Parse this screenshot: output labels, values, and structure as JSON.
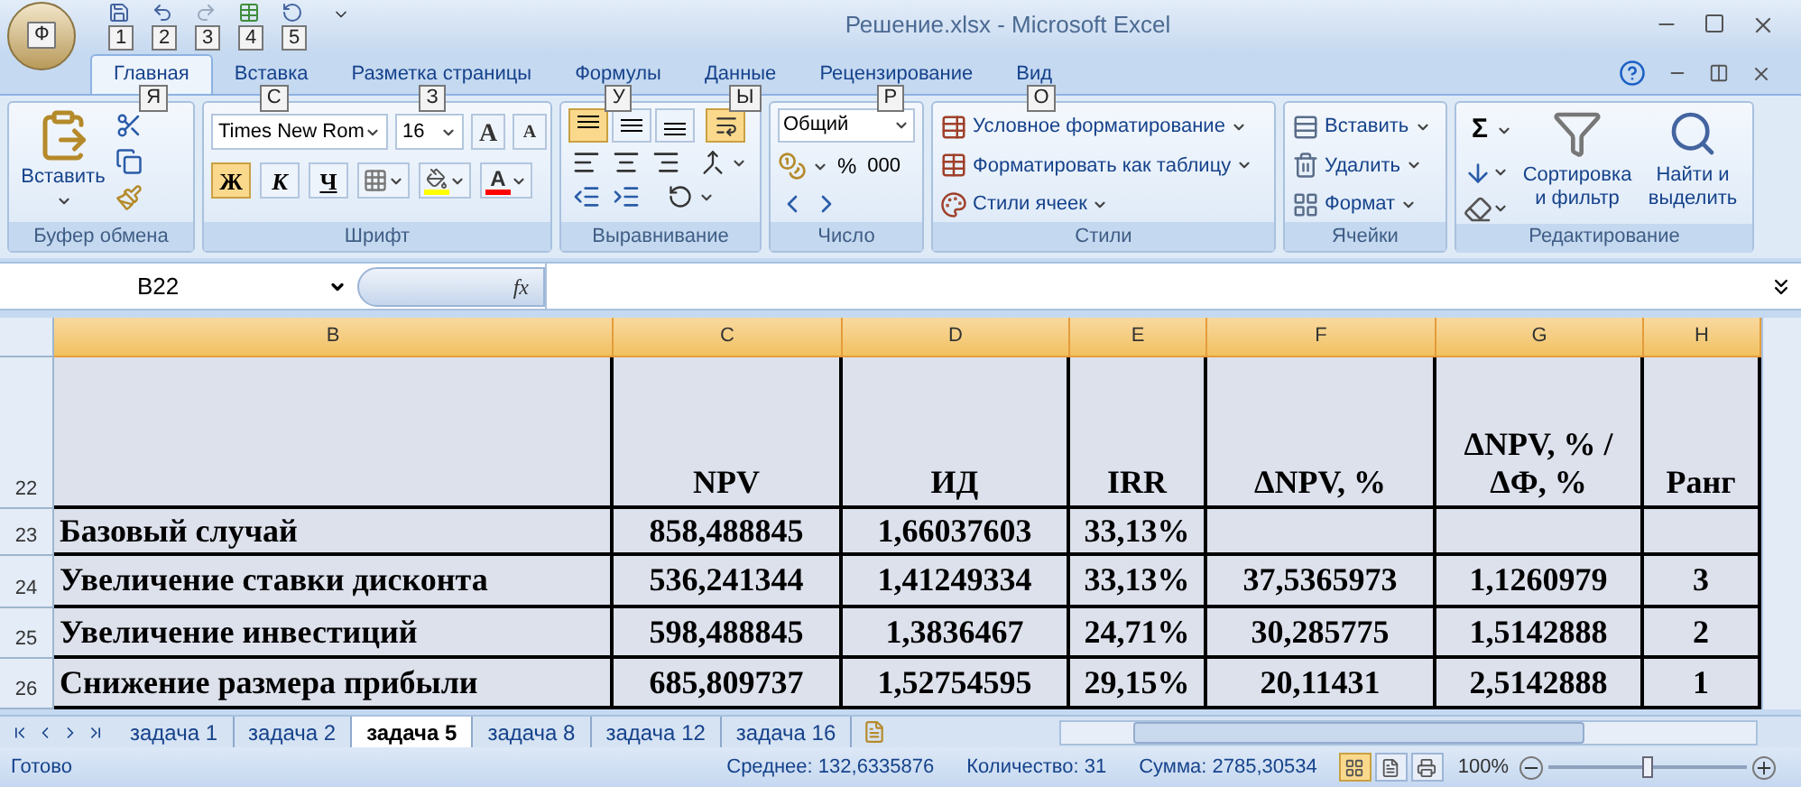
{
  "window": {
    "title": "Решение.xlsx - Microsoft Excel",
    "office_keytip": "Ф",
    "quick_access_keytips": [
      "1",
      "2",
      "3",
      "4",
      "5"
    ]
  },
  "tabs": [
    {
      "label": "Главная",
      "selected": true,
      "keytip": "Я"
    },
    {
      "label": "Вставка",
      "selected": false,
      "keytip": "С"
    },
    {
      "label": "Разметка страницы",
      "selected": false,
      "keytip": "З"
    },
    {
      "label": "Формулы",
      "selected": false,
      "keytip": "У"
    },
    {
      "label": "Данные",
      "selected": false,
      "keytip": "Ы"
    },
    {
      "label": "Рецензирование",
      "selected": false,
      "keytip": "Р"
    },
    {
      "label": "Вид",
      "selected": false,
      "keytip": "О"
    }
  ],
  "ribbon": {
    "clipboard": {
      "title": "Буфер обмена",
      "paste": "Вставить"
    },
    "font": {
      "title": "Шрифт",
      "font_name": "Times New Rom",
      "font_size": "16",
      "grow": "A",
      "shrink": "A",
      "styles": [
        {
          "label": "Ж",
          "kind": "bold",
          "on": true
        },
        {
          "label": "К",
          "kind": "italic",
          "on": false
        },
        {
          "label": "Ч",
          "kind": "underline",
          "on": false
        }
      ],
      "font_color_label": "A"
    },
    "alignment": {
      "title": "Выравнивание",
      "vertical": [
        {
          "kind": "top",
          "on": true
        },
        {
          "kind": "middle",
          "on": false
        },
        {
          "kind": "bottom",
          "on": false
        }
      ],
      "wrap_on": true
    },
    "number": {
      "title": "Число",
      "format": "Общий",
      "percent": "%",
      "thousands": "000"
    },
    "styles": {
      "title": "Стили",
      "items": [
        "Условное форматирование",
        "Форматировать как таблицу",
        "Стили ячеек"
      ]
    },
    "cells": {
      "title": "Ячейки",
      "items": [
        "Вставить",
        "Удалить",
        "Формат"
      ]
    },
    "editing": {
      "title": "Редактирование",
      "sum": "Σ",
      "sort": "Сортировка и фильтр",
      "find": "Найти и выделить"
    }
  },
  "formula_bar": {
    "name_box": "B22",
    "fx": "fx"
  },
  "table": {
    "columns": [
      {
        "label": "B",
        "selected": true
      },
      {
        "label": "C",
        "selected": true
      },
      {
        "label": "D",
        "selected": true
      },
      {
        "label": "E",
        "selected": true
      },
      {
        "label": "F",
        "selected": true
      },
      {
        "label": "G",
        "selected": true
      },
      {
        "label": "H",
        "selected": true
      }
    ],
    "rows": [
      {
        "number": "22",
        "header": true,
        "cells": [
          null,
          "NPV",
          "ИД",
          "IRR",
          "ΔNPV, %",
          "ΔNPV, % / ΔФ, %",
          "Ранг"
        ]
      },
      {
        "number": "23",
        "header": false,
        "cells": [
          "Базовый случай",
          "858,488845",
          "1,66037603",
          "33,13%",
          null,
          null,
          null
        ]
      },
      {
        "number": "24",
        "header": false,
        "cells": [
          "Увеличение ставки дисконта",
          "536,241344",
          "1,41249334",
          "33,13%",
          "37,5365973",
          "1,1260979",
          "3"
        ]
      },
      {
        "number": "25",
        "header": false,
        "cells": [
          "Увеличение инвестиций",
          "598,488845",
          "1,3836467",
          "24,71%",
          "30,285775",
          "1,5142888",
          "2"
        ]
      },
      {
        "number": "26",
        "header": false,
        "cells": [
          "Снижение размера прибыли",
          "685,809737",
          "1,52754595",
          "29,15%",
          "20,11431",
          "2,5142888",
          "1"
        ]
      }
    ]
  },
  "sheets": [
    {
      "label": "задача 1",
      "selected": false
    },
    {
      "label": "задача 2",
      "selected": false
    },
    {
      "label": "задача 5",
      "selected": true
    },
    {
      "label": "задача 8",
      "selected": false
    },
    {
      "label": "задача 12",
      "selected": false
    },
    {
      "label": "задача 16",
      "selected": false
    }
  ],
  "status_bar": {
    "status": "Готово",
    "average": "Среднее: 132,6335876",
    "count": "Количество: 31",
    "sum": "Сумма: 2785,30534",
    "views": [
      {
        "kind": "normal",
        "selected": true
      },
      {
        "kind": "layout",
        "selected": false
      },
      {
        "kind": "preview",
        "selected": false
      }
    ],
    "zoom": "100%",
    "zoom_slider": {
      "level": 0.5
    }
  }
}
